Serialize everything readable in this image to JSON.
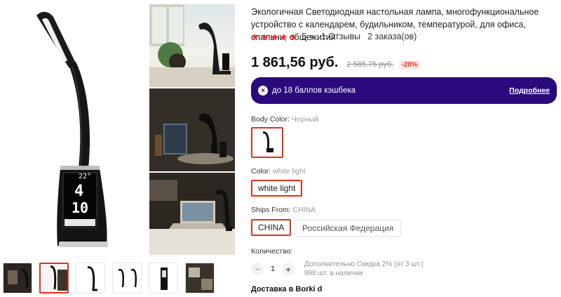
{
  "product": {
    "title": "Экологичная Светодиодная настольная лампа, многофункциональное устройство с календарем, будильником, температурой, для офиса, спальни, общежития",
    "rating": "5",
    "reviews": "1 Отзывы",
    "orders": "2 заказа(ов)",
    "price": "1 861,56 руб.",
    "old_price": "2 585,75 руб.",
    "discount": "-28%"
  },
  "cashback": {
    "text": "до 18 баллов кэшбека",
    "more": "Подробнее"
  },
  "options": {
    "body_color_label": "Body Color: ",
    "body_color_value": "Черный",
    "color_label": "Color: ",
    "color_value": "white light",
    "color_chip": "white light",
    "ships_label": "Ships From: ",
    "ships_value": "CHINA",
    "ships_chip_1": "CHINA",
    "ships_chip_2": "Российская Федерация"
  },
  "quantity": {
    "label": "Количество:",
    "value": "1",
    "minus": "−",
    "plus": "+",
    "discount_note": "Дополнительно Скидка 2% (от 3 шт.)",
    "stock": "998 шт. в наличии"
  },
  "delivery": "Доставка в Borki d",
  "lamp_display": {
    "temp": "22°",
    "hour": "4",
    "minute": "10"
  },
  "colors": {
    "accent": "#e0321c",
    "star": "#f0342c",
    "cashback_bg": "#2a0a7d"
  },
  "icons": {
    "star": "★",
    "chevron": "∨",
    "cashback": "×"
  }
}
